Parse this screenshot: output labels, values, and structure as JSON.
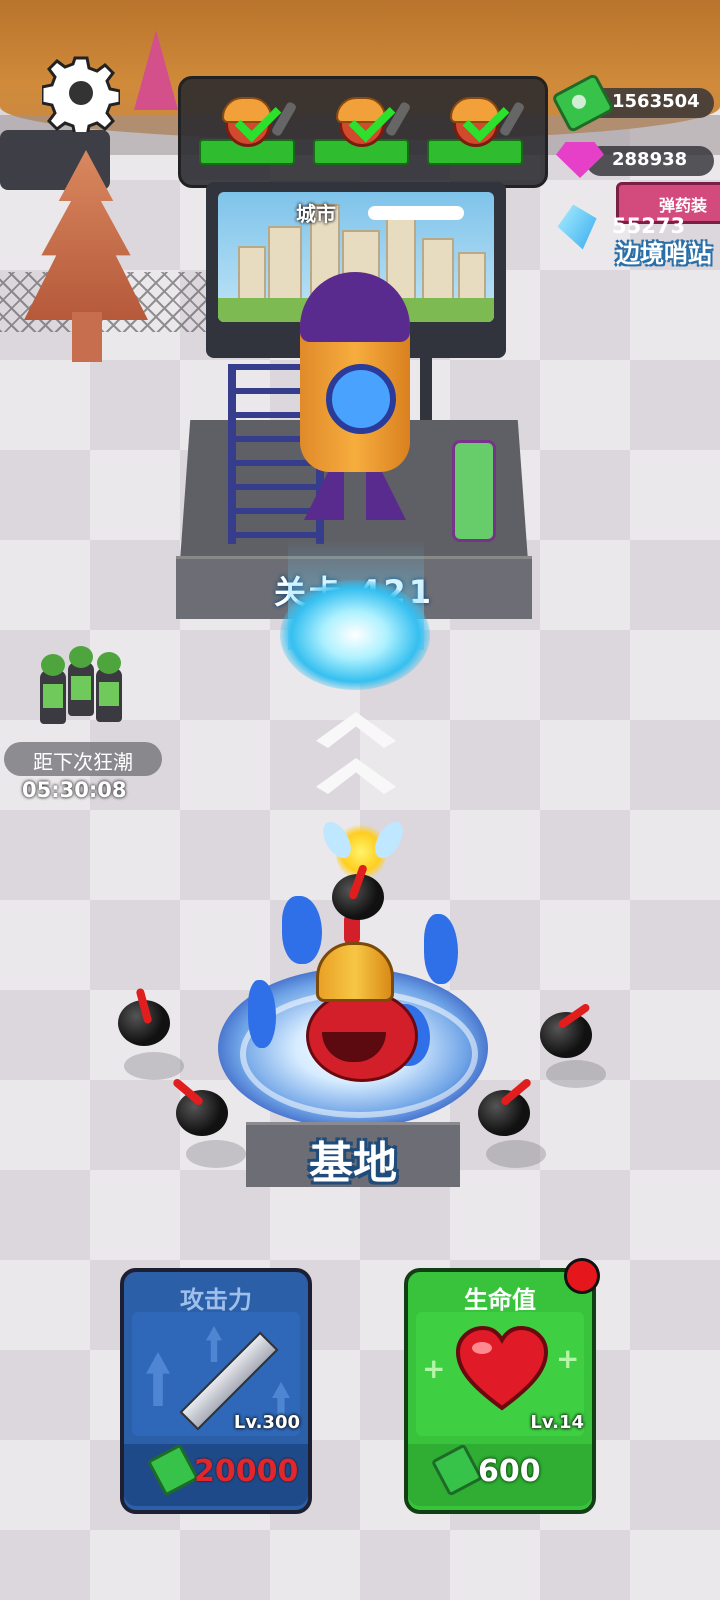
{
  "hud": {
    "currencies": [
      {
        "name": "cash",
        "value": "1563504"
      },
      {
        "name": "gems",
        "value": "288938"
      },
      {
        "name": "crystals",
        "value": "55273"
      }
    ],
    "ammo_sign": "弹药装",
    "border_post": "边境哨站"
  },
  "monitor": {
    "location": "城市"
  },
  "stage": {
    "level_label": "关卡 421"
  },
  "wave": {
    "label": "距下次狂潮",
    "timer": "05:30:08"
  },
  "base": {
    "label": "基地"
  },
  "upgrades": [
    {
      "title": "攻击力",
      "level": "Lv.300",
      "price": "20000",
      "color": "#2b5fa8"
    },
    {
      "title": "生命值",
      "level": "Lv.14",
      "price": "600",
      "color": "#39c23c"
    }
  ],
  "colors": {
    "cash": "#37c24a",
    "gem": "#e640c9",
    "crystal": "#32a9ee",
    "notification": "#e5161c"
  }
}
